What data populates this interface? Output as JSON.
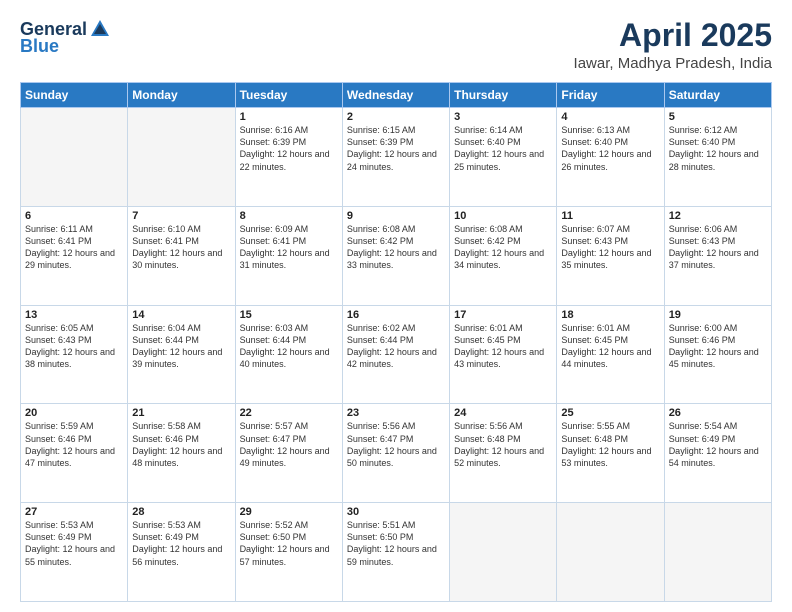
{
  "header": {
    "logo_general": "General",
    "logo_blue": "Blue",
    "month_title": "April 2025",
    "location": "Iawar, Madhya Pradesh, India"
  },
  "days_of_week": [
    "Sunday",
    "Monday",
    "Tuesday",
    "Wednesday",
    "Thursday",
    "Friday",
    "Saturday"
  ],
  "weeks": [
    [
      {
        "day": "",
        "info": ""
      },
      {
        "day": "",
        "info": ""
      },
      {
        "day": "1",
        "info": "Sunrise: 6:16 AM\nSunset: 6:39 PM\nDaylight: 12 hours and 22 minutes."
      },
      {
        "day": "2",
        "info": "Sunrise: 6:15 AM\nSunset: 6:39 PM\nDaylight: 12 hours and 24 minutes."
      },
      {
        "day": "3",
        "info": "Sunrise: 6:14 AM\nSunset: 6:40 PM\nDaylight: 12 hours and 25 minutes."
      },
      {
        "day": "4",
        "info": "Sunrise: 6:13 AM\nSunset: 6:40 PM\nDaylight: 12 hours and 26 minutes."
      },
      {
        "day": "5",
        "info": "Sunrise: 6:12 AM\nSunset: 6:40 PM\nDaylight: 12 hours and 28 minutes."
      }
    ],
    [
      {
        "day": "6",
        "info": "Sunrise: 6:11 AM\nSunset: 6:41 PM\nDaylight: 12 hours and 29 minutes."
      },
      {
        "day": "7",
        "info": "Sunrise: 6:10 AM\nSunset: 6:41 PM\nDaylight: 12 hours and 30 minutes."
      },
      {
        "day": "8",
        "info": "Sunrise: 6:09 AM\nSunset: 6:41 PM\nDaylight: 12 hours and 31 minutes."
      },
      {
        "day": "9",
        "info": "Sunrise: 6:08 AM\nSunset: 6:42 PM\nDaylight: 12 hours and 33 minutes."
      },
      {
        "day": "10",
        "info": "Sunrise: 6:08 AM\nSunset: 6:42 PM\nDaylight: 12 hours and 34 minutes."
      },
      {
        "day": "11",
        "info": "Sunrise: 6:07 AM\nSunset: 6:43 PM\nDaylight: 12 hours and 35 minutes."
      },
      {
        "day": "12",
        "info": "Sunrise: 6:06 AM\nSunset: 6:43 PM\nDaylight: 12 hours and 37 minutes."
      }
    ],
    [
      {
        "day": "13",
        "info": "Sunrise: 6:05 AM\nSunset: 6:43 PM\nDaylight: 12 hours and 38 minutes."
      },
      {
        "day": "14",
        "info": "Sunrise: 6:04 AM\nSunset: 6:44 PM\nDaylight: 12 hours and 39 minutes."
      },
      {
        "day": "15",
        "info": "Sunrise: 6:03 AM\nSunset: 6:44 PM\nDaylight: 12 hours and 40 minutes."
      },
      {
        "day": "16",
        "info": "Sunrise: 6:02 AM\nSunset: 6:44 PM\nDaylight: 12 hours and 42 minutes."
      },
      {
        "day": "17",
        "info": "Sunrise: 6:01 AM\nSunset: 6:45 PM\nDaylight: 12 hours and 43 minutes."
      },
      {
        "day": "18",
        "info": "Sunrise: 6:01 AM\nSunset: 6:45 PM\nDaylight: 12 hours and 44 minutes."
      },
      {
        "day": "19",
        "info": "Sunrise: 6:00 AM\nSunset: 6:46 PM\nDaylight: 12 hours and 45 minutes."
      }
    ],
    [
      {
        "day": "20",
        "info": "Sunrise: 5:59 AM\nSunset: 6:46 PM\nDaylight: 12 hours and 47 minutes."
      },
      {
        "day": "21",
        "info": "Sunrise: 5:58 AM\nSunset: 6:46 PM\nDaylight: 12 hours and 48 minutes."
      },
      {
        "day": "22",
        "info": "Sunrise: 5:57 AM\nSunset: 6:47 PM\nDaylight: 12 hours and 49 minutes."
      },
      {
        "day": "23",
        "info": "Sunrise: 5:56 AM\nSunset: 6:47 PM\nDaylight: 12 hours and 50 minutes."
      },
      {
        "day": "24",
        "info": "Sunrise: 5:56 AM\nSunset: 6:48 PM\nDaylight: 12 hours and 52 minutes."
      },
      {
        "day": "25",
        "info": "Sunrise: 5:55 AM\nSunset: 6:48 PM\nDaylight: 12 hours and 53 minutes."
      },
      {
        "day": "26",
        "info": "Sunrise: 5:54 AM\nSunset: 6:49 PM\nDaylight: 12 hours and 54 minutes."
      }
    ],
    [
      {
        "day": "27",
        "info": "Sunrise: 5:53 AM\nSunset: 6:49 PM\nDaylight: 12 hours and 55 minutes."
      },
      {
        "day": "28",
        "info": "Sunrise: 5:53 AM\nSunset: 6:49 PM\nDaylight: 12 hours and 56 minutes."
      },
      {
        "day": "29",
        "info": "Sunrise: 5:52 AM\nSunset: 6:50 PM\nDaylight: 12 hours and 57 minutes."
      },
      {
        "day": "30",
        "info": "Sunrise: 5:51 AM\nSunset: 6:50 PM\nDaylight: 12 hours and 59 minutes."
      },
      {
        "day": "",
        "info": ""
      },
      {
        "day": "",
        "info": ""
      },
      {
        "day": "",
        "info": ""
      }
    ]
  ]
}
